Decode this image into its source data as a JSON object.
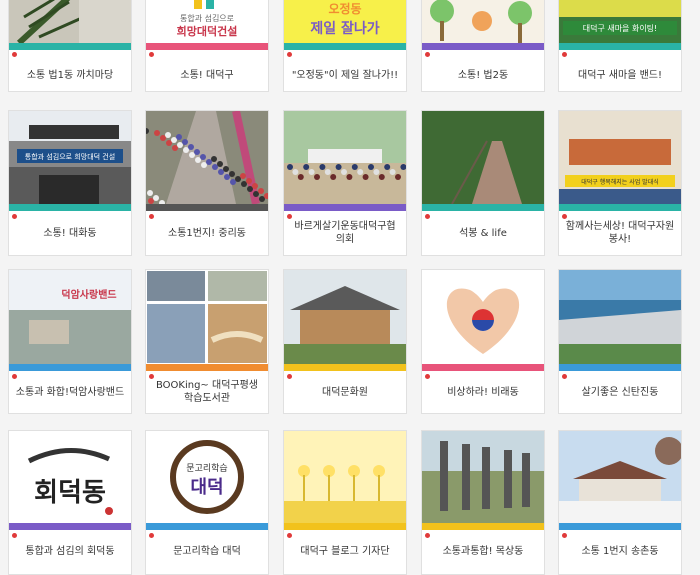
{
  "theme": {
    "dot_color": "#e03a3a",
    "title_color": "#333333",
    "background": "#f4f4f4"
  },
  "cards": [
    {
      "title": "소통 법1동 까치마당",
      "bar_color": "#2ab3a6",
      "image": "pine-branch-photo"
    },
    {
      "title": "소통! 대덕구",
      "bar_color": "#e8547a",
      "image": "logo-banner",
      "image_text": "통합과 섬김으로\n희망대덕건설"
    },
    {
      "title": "\"오정동\"이 제일 잘나가!!",
      "bar_color": "#2ab3a6",
      "image": "colorful-lettering",
      "image_text": "오정동\n제일 잘나가"
    },
    {
      "title": "소통! 법2동",
      "bar_color": "#7a5bc7",
      "image": "tree-illustration"
    },
    {
      "title": "대덕구 새마을 밴드!",
      "bar_color": "#2ab3a6",
      "image": "green-banner-photo",
      "image_text": "대덕구 새마을 화이팅!"
    },
    {
      "title": "소통! 대화동",
      "bar_color": "#2ab3a6",
      "image": "building-sign-photo",
      "image_text": "통합과 섬김으로 희망대덕 건설"
    },
    {
      "title": "소통1번지! 중리동",
      "bar_color": "#555555",
      "image": "crowd-parade-photo"
    },
    {
      "title": "바르게살기운동대덕구협의회",
      "bar_color": "#7a5bc7",
      "image": "group-photo"
    },
    {
      "title": "석봉 & life",
      "bar_color": "#2ab3a6",
      "image": "park-path-photo"
    },
    {
      "title": "함께사는세상!      대덕구자원봉사!",
      "bar_color": "#2ab3a6",
      "image": "hall-event-photo",
      "image_text": "대덕구 행복해지는 사업 발대식"
    },
    {
      "title": "소통과 화합!덕암사랑밴드",
      "bar_color": "#3a9ad9",
      "image": "town-photo-with-text",
      "image_text": "덕암사랑밴드"
    },
    {
      "title": "BOOKing~ 대덕구평생학습도서관",
      "bar_color": "#f08c30",
      "image": "library-collage"
    },
    {
      "title": "대덕문화원",
      "bar_color": "#f2c21c",
      "image": "korean-hanok-photo"
    },
    {
      "title": "비상하라! 비래동",
      "bar_color": "#e8547a",
      "image": "heart-hands-flag"
    },
    {
      "title": "살기좋은 신탄진동",
      "bar_color": "#3a9ad9",
      "image": "dam-photo"
    },
    {
      "title": "통합과 섬김의 회덕동",
      "bar_color": "#7a5bc7",
      "image": "calligraphy",
      "image_text": "회덕동"
    },
    {
      "title": "문고리학습 대덕",
      "bar_color": "#3a9ad9",
      "image": "circular-calligraphy-logo",
      "image_text": "문고리학습\n대덕"
    },
    {
      "title": "대덕구 블로그 기자단",
      "bar_color": "#f2c21c",
      "image": "yellow-flower-illustration"
    },
    {
      "title": "소통과통합! 목상동",
      "bar_color": "#f2c21c",
      "image": "stone-monument-photo"
    },
    {
      "title": "소통 1번지 송촌동",
      "bar_color": "#3a9ad9",
      "image": "winter-hanok-photo"
    }
  ]
}
